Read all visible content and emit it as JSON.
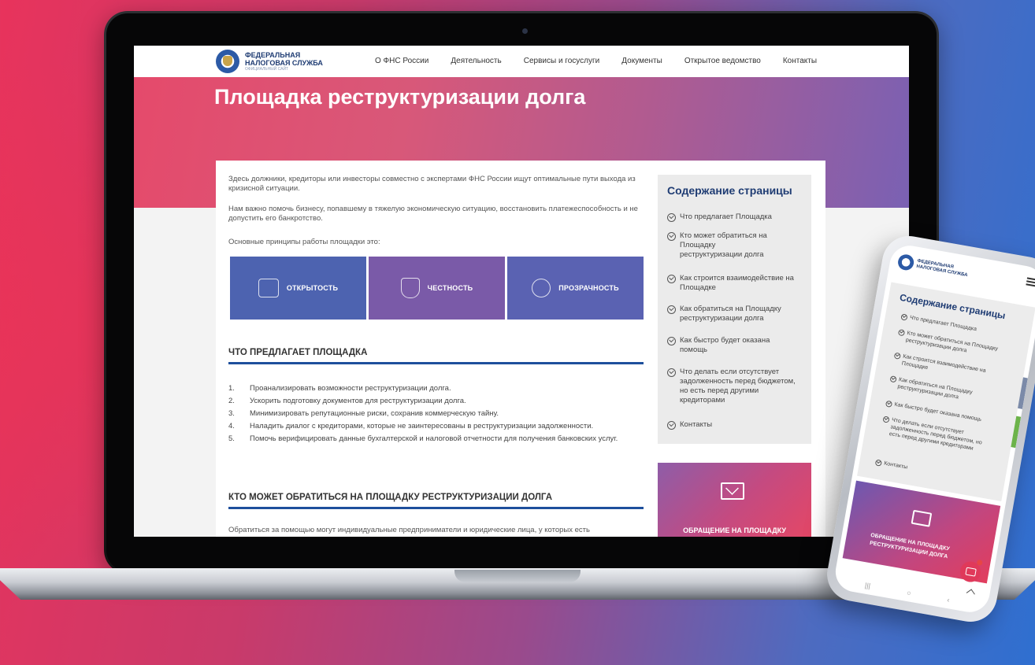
{
  "site": {
    "org_line1": "ФЕДЕРАЛЬНАЯ",
    "org_line2": "НАЛОГОВАЯ СЛУЖБА",
    "org_line3": "ОФИЦИАЛЬНЫЙ САЙТ",
    "nav": [
      "О ФНС России",
      "Деятельность",
      "Сервисы и госуслуги",
      "Документы",
      "Открытое ведомство",
      "Контакты"
    ]
  },
  "hero": {
    "title": "Площадка реструктуризации долга"
  },
  "content": {
    "intro1": "Здесь должники, кредиторы или инвесторы совместно с экспертами ФНС России ищут оптимальные пути выхода из кризисной ситуации.",
    "intro2": "Нам важно помочь бизнесу, попавшему в тяжелую экономическую ситуацию, восстановить платежеспособность и не допустить его банкротство.",
    "intro3": "Основные принципы работы площадки это:",
    "principles": [
      "ОТКРЫТОСТЬ",
      "ЧЕСТНОСТЬ",
      "ПРОЗРАЧНОСТЬ"
    ],
    "section1_title": "ЧТО ПРЕДЛАГАЕТ ПЛОЩАДКА",
    "offers": [
      {
        "num": "1.",
        "text": "Проанализировать возможности реструктуризации долга."
      },
      {
        "num": "2.",
        "text": "Ускорить подготовку документов для реструктуризации долга."
      },
      {
        "num": "3.",
        "text": "Минимизировать репутационные риски, сохранив коммерческую тайну."
      },
      {
        "num": "4.",
        "text": "Наладить диалог с кредиторами, которые не заинтересованы в реструктуризации задолженности."
      },
      {
        "num": "5.",
        "text": "Помочь верифицировать данные бухгалтерской и налоговой отчетности для получения банковских услуг."
      }
    ],
    "section2_title": "КТО МОЖЕТ ОБРАТИТЬСЯ НА ПЛОЩАДКУ РЕСТРУКТУРИЗАЦИИ ДОЛГА",
    "section2_text": "Обратиться за помощью могут индивидуальные предприниматели и юридические лица, у которых есть"
  },
  "toc": {
    "title": "Содержание страницы",
    "items": [
      "Что предлагает Площадка",
      "Кто может обратиться на Площадку реструктуризации долга",
      "Как строится взаимодействие на Площадке",
      "Как обратиться на Площадку реструктуризации долга",
      "Как быстро будет оказана помощь",
      "Что делать если отсутствует задолженность перед бюджетом, но есть перед другими кредиторами",
      "Контакты"
    ],
    "appeal_label": "ОБРАЩЕНИЕ НА ПЛОЩАДКУ"
  },
  "phone": {
    "toc_title": "Содержание страницы",
    "items": [
      "Что предлагает Площадка",
      "Кто может обратиться на Площадку реструктуризации долга",
      "Как строится взаимодействие на Площадке",
      "Как обратиться на Площадку реструктуризации долга",
      "Как быстро будет оказана помощь",
      "Что делать если отсутствует задолженность перед бюджетом, но есть перед другими кредиторами",
      "Контакты"
    ],
    "appeal_line1": "ОБРАЩЕНИЕ НА ПЛОЩАДКУ",
    "appeal_line2": "РЕСТРУКТУРИЗАЦИИ ДОЛГА"
  },
  "icons": [
    "crowd-icon",
    "shield-people-icon",
    "magnifier-icon",
    "envelope-pen-icon",
    "chat-icon",
    "hamburger-menu-icon",
    "checkmark-circle-icon"
  ],
  "colors": {
    "brand_blue": "#1f3c73",
    "principle_boxes": [
      "#4d63b0",
      "#7a5aa8",
      "#5a62b2"
    ],
    "section_underline": "#1e4f9c"
  }
}
